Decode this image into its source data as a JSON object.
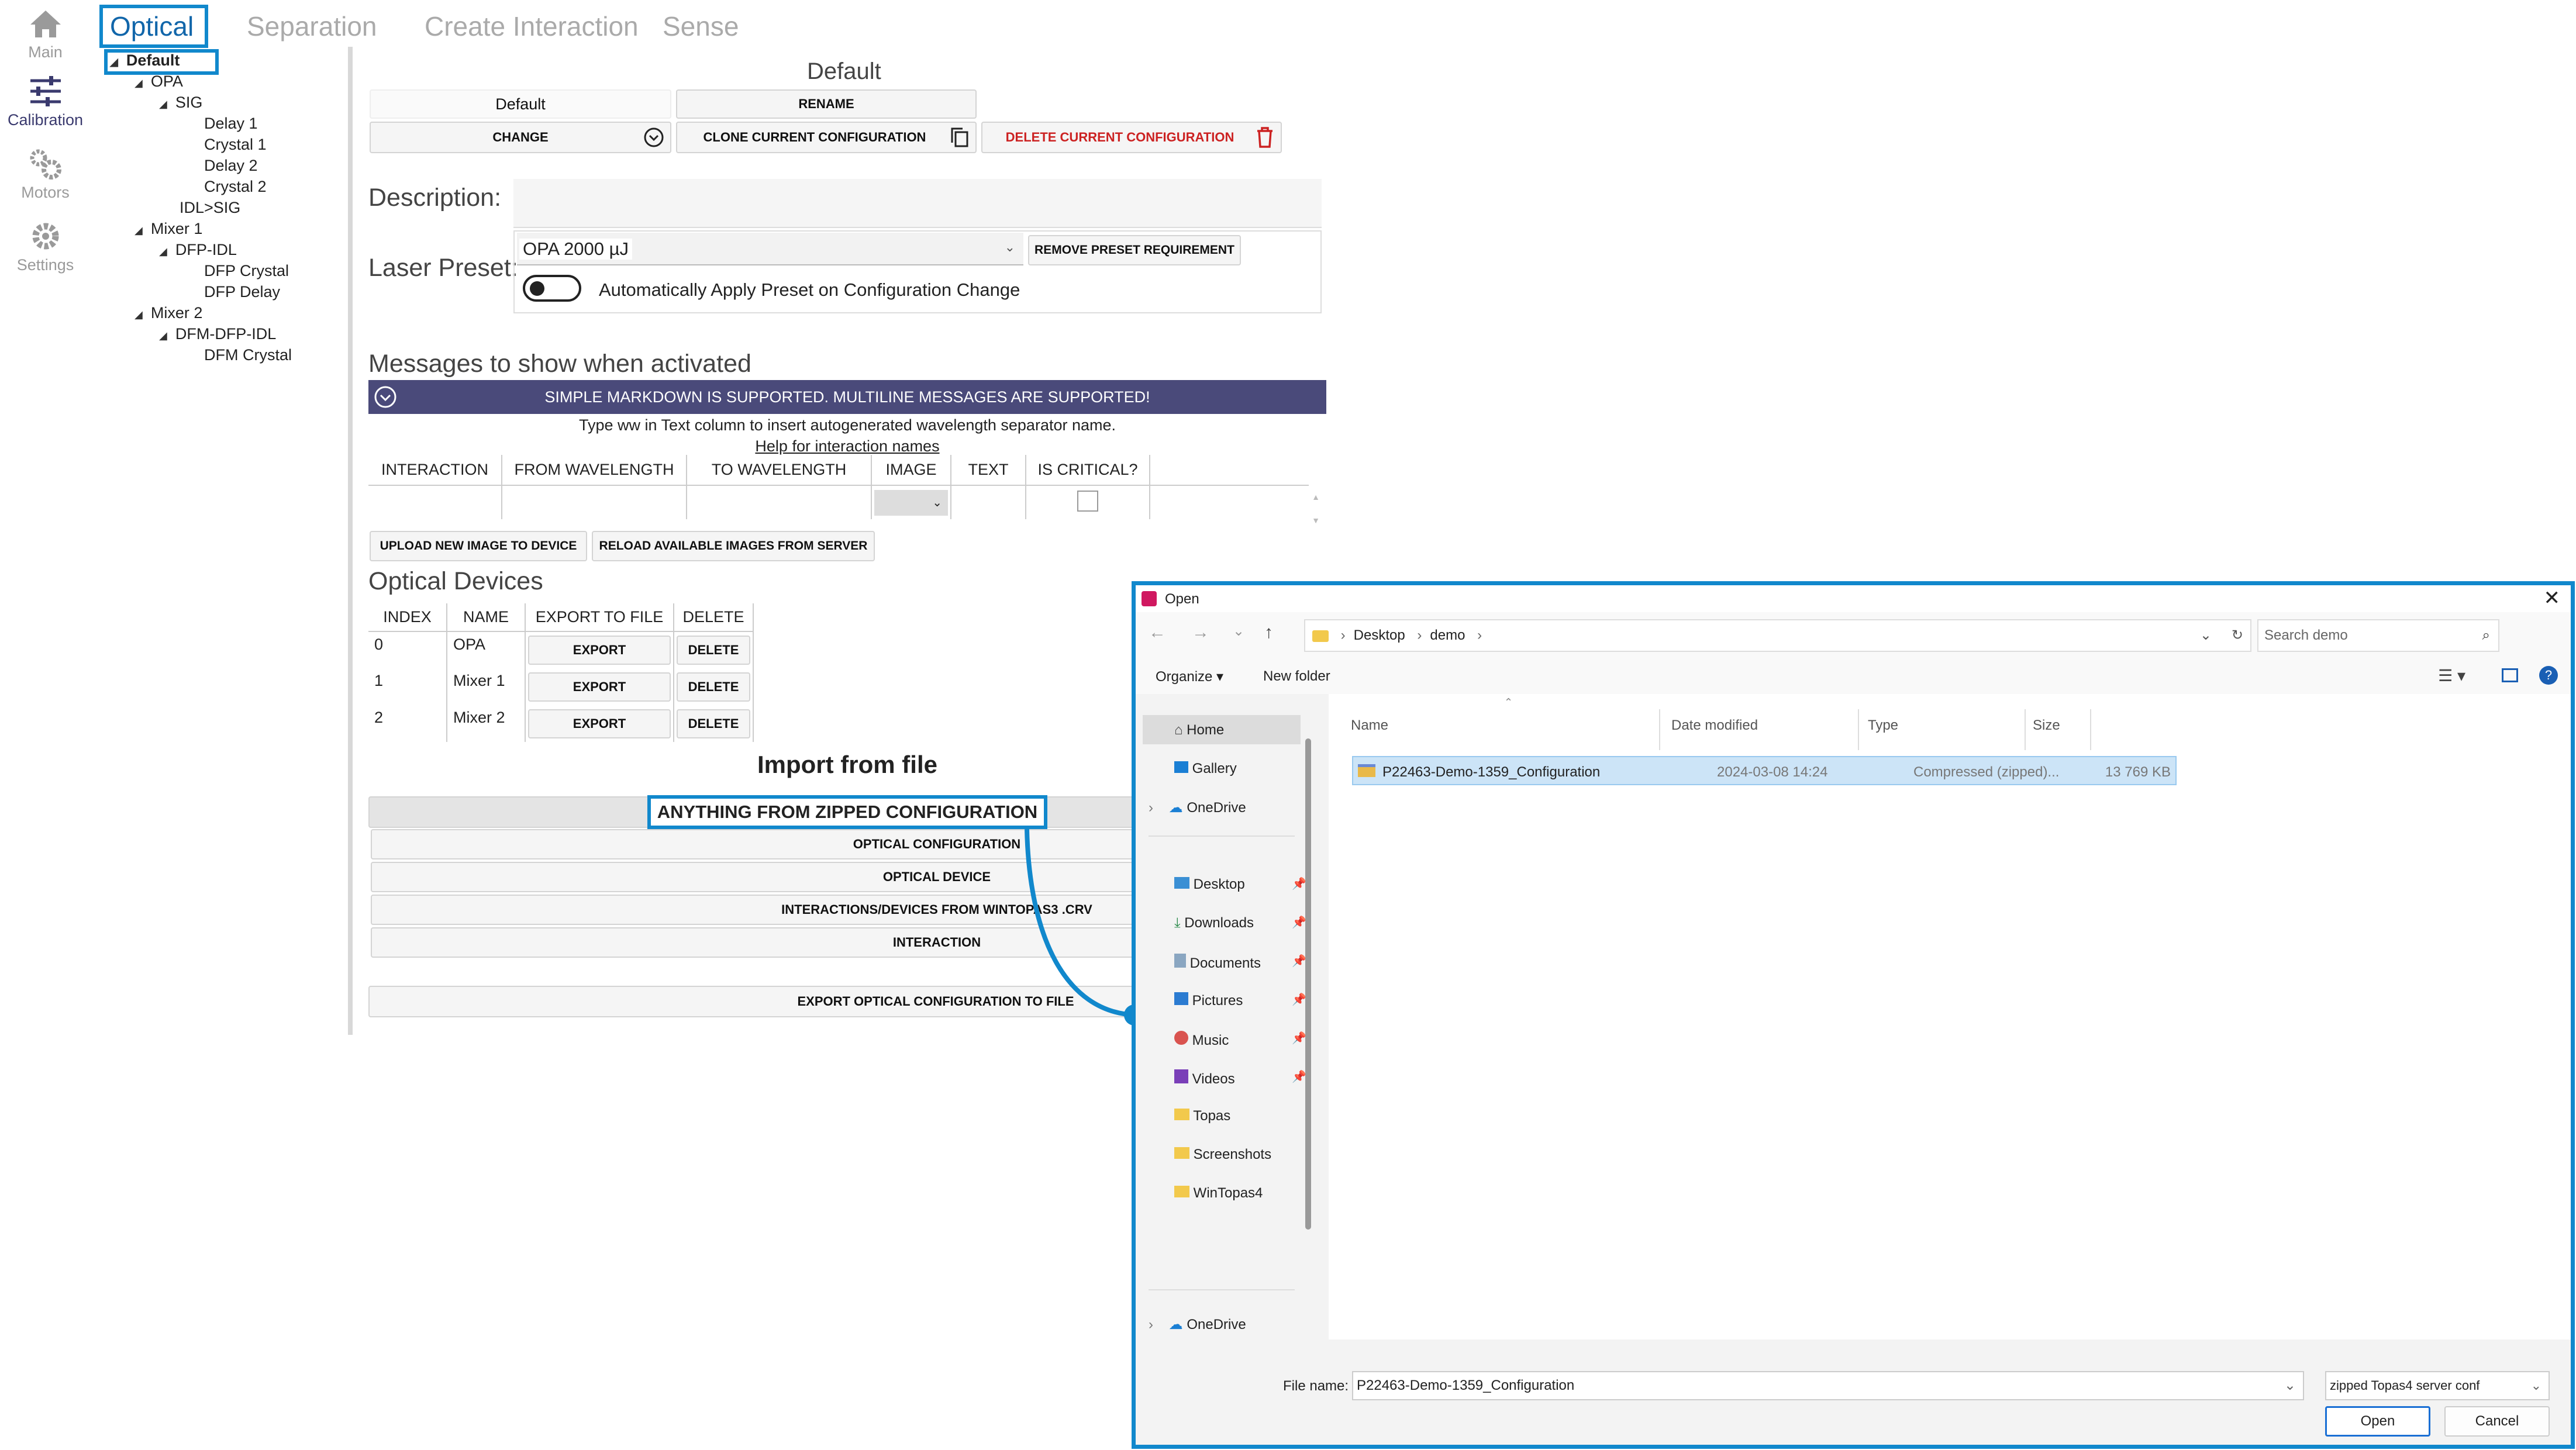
{
  "nav": [
    {
      "label": "Main",
      "icon": "home-icon"
    },
    {
      "label": "Calibration",
      "icon": "sliders-icon"
    },
    {
      "label": "Motors",
      "icon": "gears-icon"
    },
    {
      "label": "Settings",
      "icon": "gear-icon"
    }
  ],
  "tabs": [
    "Optical",
    "Separation",
    "Create Interaction",
    "Sense"
  ],
  "tree": {
    "root": "Default",
    "opa": "OPA",
    "sig": "SIG",
    "delay1": "Delay 1",
    "crystal1": "Crystal 1",
    "delay2": "Delay 2",
    "crystal2": "Crystal 2",
    "idlsig": "IDL>SIG",
    "mixer1": "Mixer 1",
    "dfpidl": "DFP-IDL",
    "dfpcrystal": "DFP Crystal",
    "dfpdelay": "DFP Delay",
    "mixer2": "Mixer 2",
    "dfmdfpidl": "DFM-DFP-IDL",
    "dfmcrystal": "DFM Crystal"
  },
  "config": {
    "title": "Default",
    "current": "Default",
    "rename": "RENAME",
    "change": "CHANGE",
    "clone": "CLONE CURRENT CONFIGURATION",
    "delete": "DELETE CURRENT CONFIGURATION"
  },
  "description_label": "Description:",
  "laser": {
    "label": "Laser Preset:",
    "value": "OPA 2000 µJ",
    "remove": "REMOVE PRESET REQUIREMENT",
    "toggle_label": "Automatically Apply Preset on Configuration Change"
  },
  "messages": {
    "title": "Messages to show when activated",
    "banner": "SIMPLE MARKDOWN IS SUPPORTED. MULTILINE MESSAGES ARE SUPPORTED!",
    "hint": "Type ww in Text column to insert autogenerated wavelength separator name.",
    "help": "Help for interaction names",
    "columns": [
      "INTERACTION",
      "FROM WAVELENGTH",
      "TO WAVELENGTH",
      "IMAGE",
      "TEXT",
      "IS CRITICAL?"
    ],
    "upload": "UPLOAD NEW IMAGE TO DEVICE",
    "reload": "RELOAD AVAILABLE IMAGES FROM SERVER"
  },
  "devices": {
    "title": "Optical Devices",
    "columns": [
      "INDEX",
      "NAME",
      "EXPORT TO FILE",
      "DELETE"
    ],
    "rows": [
      {
        "index": "0",
        "name": "OPA",
        "export": "EXPORT",
        "delete": "DELETE"
      },
      {
        "index": "1",
        "name": "Mixer 1",
        "export": "EXPORT",
        "delete": "DELETE"
      },
      {
        "index": "2",
        "name": "Mixer 2",
        "export": "EXPORT",
        "delete": "DELETE"
      }
    ]
  },
  "import": {
    "title": "Import from file",
    "anything": "ANYTHING FROM ZIPPED CONFIGURATION",
    "optical_config": "OPTICAL CONFIGURATION",
    "optical_device": "OPTICAL DEVICE",
    "interactions": "INTERACTIONS/DEVICES FROM WINTOPAS3 .CRV",
    "interaction": "INTERACTION",
    "export": "EXPORT OPTICAL CONFIGURATION TO FILE"
  },
  "dialog": {
    "title": "Open",
    "path": [
      "Desktop",
      "demo"
    ],
    "search_placeholder": "Search demo",
    "organize": "Organize",
    "new_folder": "New folder",
    "sidebar": [
      "Home",
      "Gallery",
      "OneDrive",
      "Desktop",
      "Downloads",
      "Documents",
      "Pictures",
      "Music",
      "Videos",
      "Topas",
      "Screenshots",
      "WinTopas4",
      "OneDrive"
    ],
    "columns": [
      "Name",
      "Date modified",
      "Type",
      "Size"
    ],
    "file": {
      "name": "P22463-Demo-1359_Configuration",
      "date": "2024-03-08 14:24",
      "type": "Compressed (zipped)...",
      "size": "13 769 KB"
    },
    "file_name_label": "File name:",
    "file_name_value": "P22463-Demo-1359_Configuration",
    "filter": "zipped Topas4 server conf",
    "open": "Open",
    "cancel": "Cancel"
  },
  "colors": {
    "accent": "#1188cc",
    "banner": "#4a4a7a",
    "danger": "#cc2222",
    "selected": "#cce4f7"
  }
}
